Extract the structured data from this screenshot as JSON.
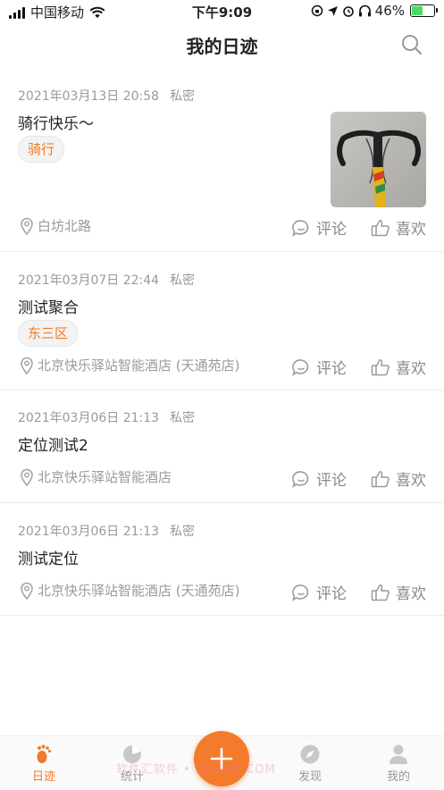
{
  "status_bar": {
    "carrier": "中国移动",
    "time": "下午9:09",
    "battery": "46%"
  },
  "header": {
    "title": "我的日迹",
    "search_icon": "search-icon"
  },
  "entries": [
    {
      "datetime": "2021年03月13日 20:58",
      "privacy": "私密",
      "title": "骑行快乐～",
      "tag": "骑行",
      "location": "白坊北路",
      "comment_label": "评论",
      "like_label": "喜欢",
      "has_photo": true
    },
    {
      "datetime": "2021年03月07日 22:44",
      "privacy": "私密",
      "title": "测试聚合",
      "tag": "东三区",
      "location": "北京快乐驿站智能酒店 (天通苑店)",
      "comment_label": "评论",
      "like_label": "喜欢"
    },
    {
      "datetime": "2021年03月06日 21:13",
      "privacy": "私密",
      "title": "定位测试2",
      "location": "北京快乐驿站智能酒店",
      "comment_label": "评论",
      "like_label": "喜欢"
    },
    {
      "datetime": "2021年03月06日 21:13",
      "privacy": "私密",
      "title": "测试定位",
      "location": "北京快乐驿站智能酒店 (天通苑店)",
      "comment_label": "评论",
      "like_label": "喜欢"
    }
  ],
  "tabbar": {
    "tabs": [
      {
        "label": "日迹",
        "icon": "footprint-icon",
        "active": true
      },
      {
        "label": "统计",
        "icon": "pie-chart-icon",
        "active": false
      },
      {
        "label": "发现",
        "icon": "compass-icon",
        "active": false
      },
      {
        "label": "我的",
        "icon": "user-icon",
        "active": false
      }
    ],
    "add_icon": "plus-icon"
  },
  "watermark": "软件汇软件 • ZJHHRJ.COM",
  "colors": {
    "accent": "#f07a2a",
    "meta_text": "#9a9a9a",
    "battery_green": "#4cd964"
  }
}
